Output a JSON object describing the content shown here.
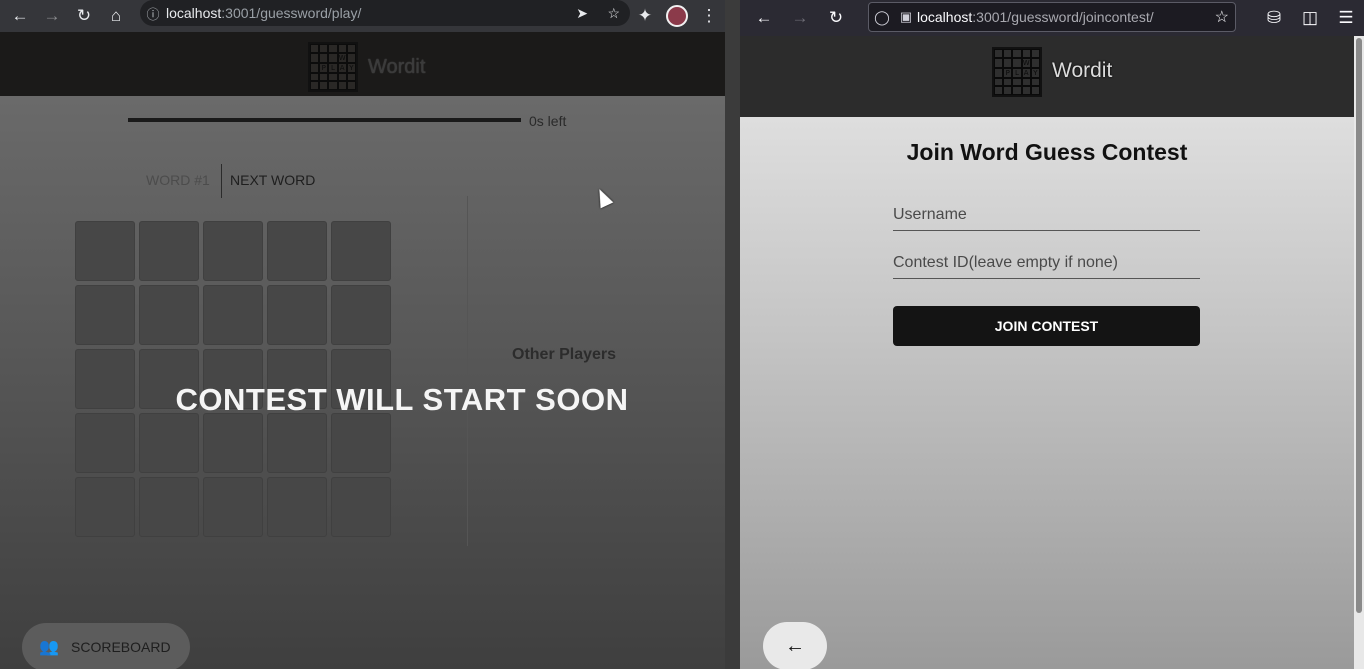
{
  "left_window": {
    "browser": {
      "url_host": "localhost",
      "url_rest": ":3001/guessword/play/",
      "icons": [
        "back-icon",
        "forward-icon",
        "reload-icon",
        "home-icon",
        "info-icon",
        "send-icon",
        "star-icon",
        "extensions-icon",
        "avatar",
        "menu-icon"
      ]
    },
    "app": {
      "brand": "Wordit",
      "logo_letters": [
        "",
        "",
        "",
        "",
        "",
        "",
        "",
        "",
        "W",
        "",
        "",
        "P",
        "L",
        "A",
        "Y",
        "",
        "",
        "",
        "",
        "",
        "",
        "",
        "",
        "",
        ""
      ],
      "timer_label": "0s left",
      "tabs": [
        {
          "label": "WORD #1"
        },
        {
          "label": "NEXT WORD"
        }
      ],
      "grid_rows": 5,
      "grid_cols": 5,
      "other_players": "Other Players",
      "overlay_message": "CONTEST WILL START SOON",
      "scoreboard_label": "SCOREBOARD"
    }
  },
  "right_window": {
    "browser": {
      "url_host": "localhost",
      "url_rest": ":3001/guessword/joincontest/",
      "icons": [
        "back-icon",
        "forward-icon",
        "reload-icon",
        "shield-icon",
        "page-icon",
        "star-icon",
        "pocket-icon",
        "sidebar-icon",
        "menu-icon"
      ]
    },
    "app": {
      "brand": "Wordit",
      "title": "Join Word Guess Contest",
      "username_placeholder": "Username",
      "contest_placeholder": "Contest ID(leave empty if none)",
      "join_label": "JOIN CONTEST"
    }
  }
}
